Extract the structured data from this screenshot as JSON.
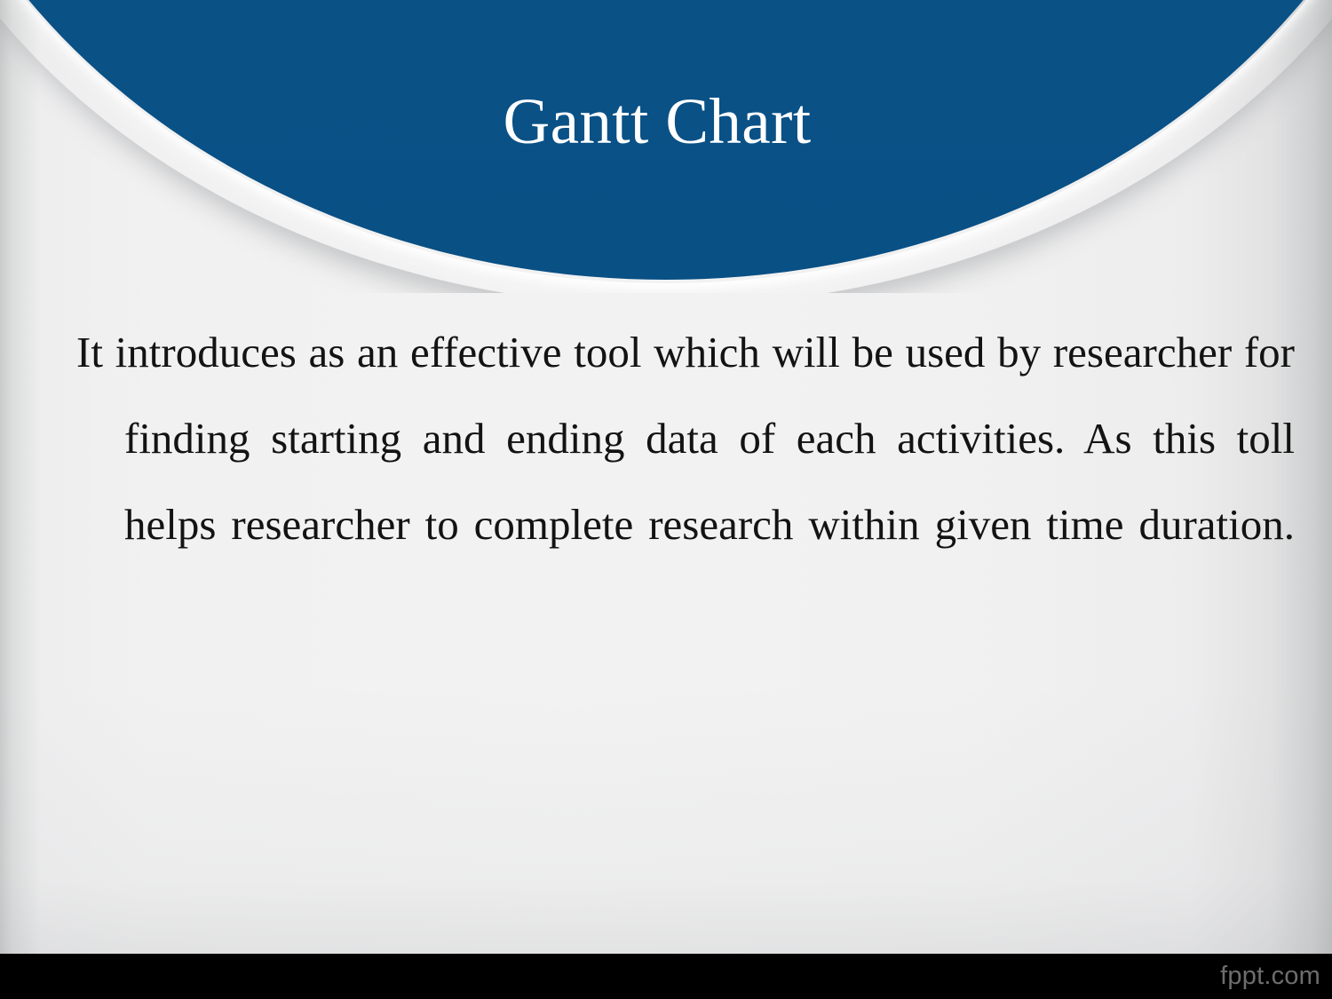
{
  "slide": {
    "title": "Gantt Chart",
    "accent_color": "#0a5489",
    "body_background_color": "#f1f1f1",
    "title_color": "#ffffff",
    "body_text_color": "#131313",
    "footer_bar_color": "#000000",
    "footer_text_color": "#6d6d6d"
  },
  "body": {
    "paragraph": "It introduces as an effective tool which will be used by researcher for finding starting and ending data of each activities. As this toll helps researcher to complete research within given time duration.",
    "lines": [
      "It introduces as an effective tool which will be used by",
      "researcher for finding starting and ending data of each",
      "activities. As this toll helps researcher to complete",
      "research within given time duration."
    ]
  },
  "footer": {
    "watermark": "fppt.com"
  }
}
